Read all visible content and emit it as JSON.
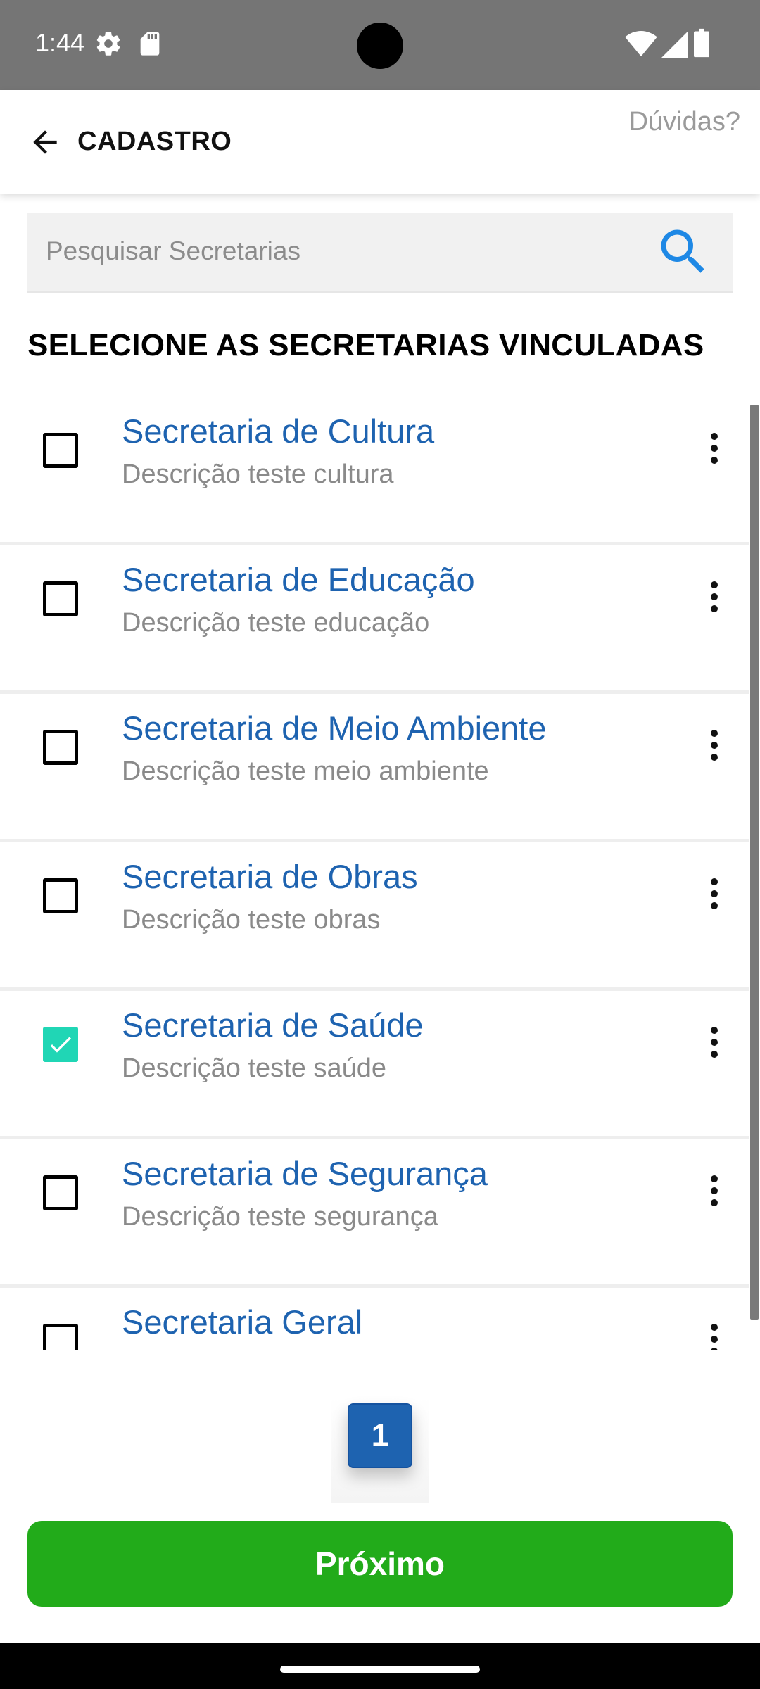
{
  "status_bar": {
    "time": "1:44",
    "icons": [
      "settings-gear-icon",
      "sd-card-icon",
      "wifi-icon",
      "signal-icon",
      "battery-icon"
    ]
  },
  "header": {
    "title": "CADASTRO",
    "back_icon": "arrow-left-icon",
    "help_label": "Dúvidas?"
  },
  "search": {
    "placeholder": "Pesquisar Secretarias",
    "value": "",
    "icon": "search-icon"
  },
  "section_title": "SELECIONE AS SECRETARIAS VINCULADAS",
  "secretarias": [
    {
      "name": "Secretaria de Cultura",
      "description": "Descrição teste cultura",
      "checked": false
    },
    {
      "name": "Secretaria de Educação",
      "description": "Descrição teste educação",
      "checked": false
    },
    {
      "name": "Secretaria de Meio Ambiente",
      "description": "Descrição teste meio ambiente",
      "checked": false
    },
    {
      "name": "Secretaria de Obras",
      "description": "Descrição teste obras",
      "checked": false
    },
    {
      "name": "Secretaria de Saúde",
      "description": "Descrição teste saúde",
      "checked": true
    },
    {
      "name": "Secretaria de Segurança",
      "description": "Descrição teste segurança",
      "checked": false
    },
    {
      "name": "Secretaria Geral",
      "description": "",
      "checked": false
    }
  ],
  "pagination": {
    "current_page": "1"
  },
  "next_button": {
    "label": "Próximo"
  },
  "colors": {
    "accent_blue": "#1e63b0",
    "checkbox_checked": "#20d6b5",
    "next_green": "#22ab1a",
    "search_icon": "#1e88e5"
  }
}
